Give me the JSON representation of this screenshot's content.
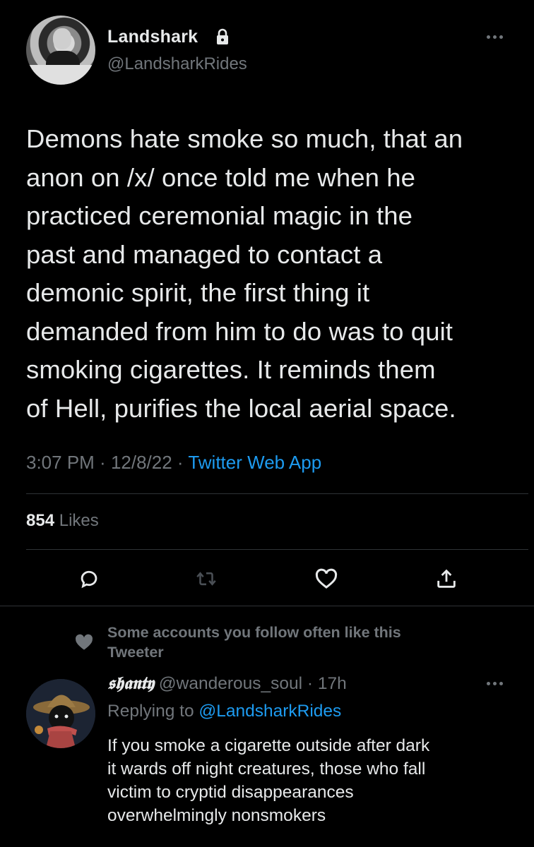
{
  "tweet": {
    "author_name": "Landshark",
    "handle": "@LandsharkRides",
    "text": "Demons hate smoke so much, that an\nanon on /x/ once told me when he\npracticed ceremonial magic in the\npast and managed to contact a\ndemonic spirit, the first thing it\ndemanded from him to do was to quit\nsmoking cigarettes. It reminds them\nof Hell, purifies the local aerial space.",
    "time": "3:07 PM",
    "date": "12/8/22",
    "separator": " · ",
    "source": "Twitter Web App",
    "likes_count": "854",
    "likes_label": "Likes"
  },
  "actions": {
    "reply_icon": "reply-icon",
    "retweet_icon": "retweet-icon",
    "like_icon": "heart-icon",
    "share_icon": "share-icon"
  },
  "reply": {
    "social_context": "Some accounts you follow often like this Tweeter",
    "author_name": "𝖘𝖍𝖆𝖓𝖙𝖞",
    "handle": "@wanderous_soul",
    "time": "17h",
    "replying_prefix": "Replying to",
    "replying_to": "@LandsharkRides",
    "text": "If you smoke a cigarette outside after dark\nit wards off night creatures, those who fall\nvictim to cryptid disappearances\noverwhelmingly nonsmokers"
  },
  "colors": {
    "background": "#000000",
    "text": "#e7e9ea",
    "secondary": "#71767b",
    "accent": "#1d9bf0",
    "divider": "#2f3336"
  }
}
